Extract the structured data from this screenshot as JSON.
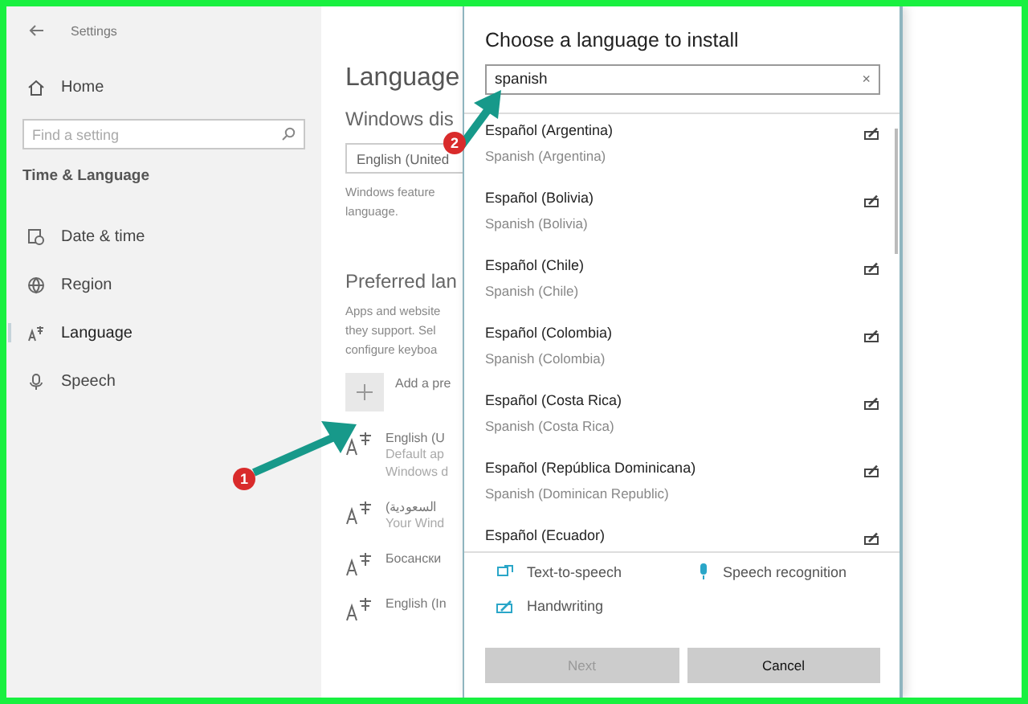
{
  "sidebar": {
    "title": "Settings",
    "home": "Home",
    "search": {
      "placeholder": "Find a setting"
    },
    "section": "Time & Language",
    "items": [
      {
        "label": "Date & time",
        "kind": "clock",
        "selected": false
      },
      {
        "label": "Region",
        "kind": "globe",
        "selected": false
      },
      {
        "label": "Language",
        "kind": "language",
        "selected": true
      },
      {
        "label": "Speech",
        "kind": "mic",
        "selected": false
      }
    ]
  },
  "main": {
    "title": "Language",
    "display_heading": "Windows dis",
    "display_value": "English (United",
    "display_note": [
      "Windows feature",
      "language."
    ],
    "preferred_heading": "Preferred lan",
    "preferred_note": [
      "Apps and website",
      "they support. Sel",
      "configure keyboa"
    ],
    "add_label": "Add a pre",
    "languages": [
      {
        "name": "English (U",
        "lines": [
          "Default ap",
          "Windows d"
        ]
      },
      {
        "name": "(السعودية",
        "lines": [
          "Your Wind"
        ]
      },
      {
        "name": "Босански"
      },
      {
        "name": "English (In"
      }
    ]
  },
  "dialog": {
    "title": "Choose a language to install",
    "search": {
      "value": "spanish",
      "clear": "×"
    },
    "results": [
      {
        "name": "Español (Argentina)",
        "english": "Spanish (Argentina)"
      },
      {
        "name": "Español (Bolivia)",
        "english": "Spanish (Bolivia)"
      },
      {
        "name": "Español (Chile)",
        "english": "Spanish (Chile)"
      },
      {
        "name": "Español (Colombia)",
        "english": "Spanish (Colombia)"
      },
      {
        "name": "Español (Costa Rica)",
        "english": "Spanish (Costa Rica)"
      },
      {
        "name": "Español (República Dominicana)",
        "english": "Spanish (Dominican Republic)"
      },
      {
        "name": "Español (Ecuador)"
      }
    ],
    "features": [
      {
        "kind": "tts",
        "label": "Text-to-speech"
      },
      {
        "kind": "speech",
        "label": "Speech recognition"
      },
      {
        "kind": "handwriting",
        "label": "Handwriting"
      }
    ],
    "buttons": [
      {
        "label": "Next",
        "disabled": true
      },
      {
        "label": "Cancel",
        "disabled": false
      }
    ]
  },
  "annotations": [
    {
      "number": "1"
    },
    {
      "number": "2"
    }
  ]
}
